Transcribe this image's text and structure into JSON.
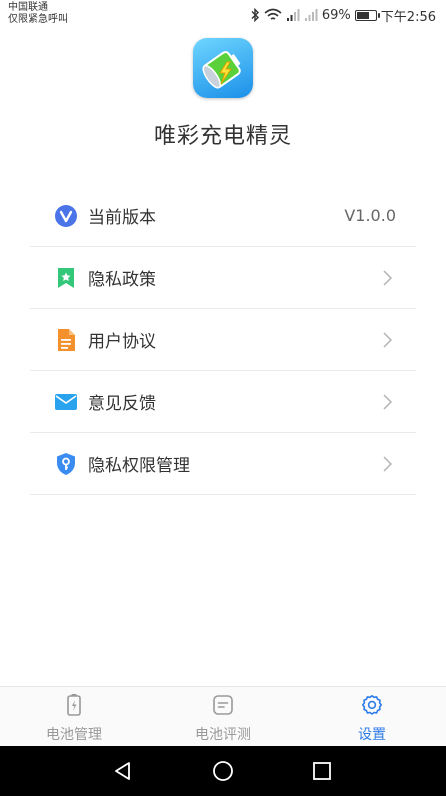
{
  "status_bar": {
    "carrier_line1": "中国联通",
    "carrier_line2": "仅限紧急呼叫",
    "battery_level": "69%",
    "battery_fraction": 0.69,
    "time": "下午2:56",
    "icons": [
      "bluetooth-icon",
      "wifi-icon",
      "signal-icon",
      "signal-icon",
      "battery-icon"
    ]
  },
  "header": {
    "app_name": "唯彩充电精灵",
    "app_icon": "battery-app-icon"
  },
  "menu": {
    "items": [
      {
        "label": "当前版本",
        "value": "V1.0.0",
        "icon": "version-v-icon",
        "icon_color": "#4a74e8"
      },
      {
        "label": "隐私政策",
        "icon": "privacy-bookmark-icon",
        "icon_color": "#33c77a"
      },
      {
        "label": "用户协议",
        "icon": "document-icon",
        "icon_color": "#f5912c"
      },
      {
        "label": "意见反馈",
        "icon": "mail-icon",
        "icon_color": "#2aa3ee"
      },
      {
        "label": "隐私权限管理",
        "icon": "shield-key-icon",
        "icon_color": "#3a8cf0"
      }
    ]
  },
  "tabs": [
    {
      "label": "电池管理",
      "icon": "battery-icon",
      "active": false
    },
    {
      "label": "电池评测",
      "icon": "note-icon",
      "active": false
    },
    {
      "label": "设置",
      "icon": "gear-icon",
      "active": true
    }
  ],
  "colors": {
    "accent": "#2d7be8",
    "inactive_tab": "#999999",
    "divider": "#ebebeb"
  }
}
